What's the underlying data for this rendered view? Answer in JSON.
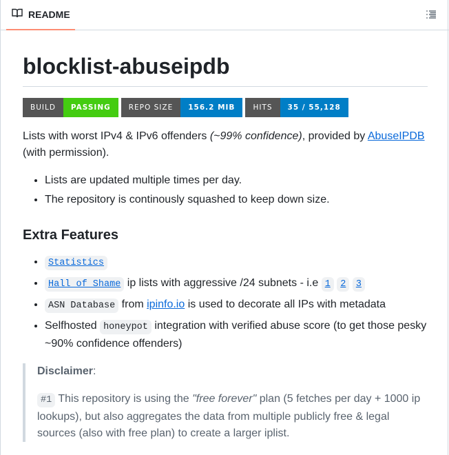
{
  "tab": {
    "label": "README",
    "icon": "book-icon"
  },
  "toc": {
    "icon": "list-icon"
  },
  "title": "blocklist-abuseipdb",
  "badges": [
    {
      "key": "BUILD",
      "value": "PASSING",
      "color": "#4c1"
    },
    {
      "key": "REPO SIZE",
      "value": "156.2 MIB",
      "color": "#007ec6"
    },
    {
      "key": "HITS",
      "value": "35 / 55,128",
      "color": "#007ec6"
    }
  ],
  "intro": {
    "text1": "Lists with worst IPv4 & IPv6 offenders ",
    "emphasis": "(~99% confidence)",
    "text2": ", provided by ",
    "link": "AbuseIPDB",
    "text3": " (with permission)."
  },
  "bullets": [
    "Lists are updated multiple times per day.",
    "The repository is continously squashed to keep down size."
  ],
  "features": {
    "heading": "Extra Features",
    "statistics": "Statistics",
    "hall_of_shame": "Hall of Shame",
    "hall_text": " ip lists with aggressive /24 subnets - i.e ",
    "hall_links": [
      "1",
      "2",
      "3"
    ],
    "asn_code": "ASN Database",
    "asn_from": " from ",
    "asn_link": "ipinfo.io",
    "asn_text": " is used to decorate all IPs with metadata",
    "self_text1": "Selfhosted ",
    "self_code": "honeypot",
    "self_text2": " integration with verified abuse score (to get those pesky ~90% confidence offenders)"
  },
  "disclaimer": {
    "title": "Disclaimer",
    "colon": ":",
    "tag": "#1",
    "text1": " This repository is using the ",
    "emphasis": "\"free forever\"",
    "text2": " plan (5 fetches per day + 1000 ip lookups), but also aggregates the data from multiple publicly free & legal sources (also with free plan) to create a larger iplist."
  },
  "colors": {
    "accent": "#fd8c73",
    "link": "#0969da",
    "badge_key": "#555555"
  }
}
